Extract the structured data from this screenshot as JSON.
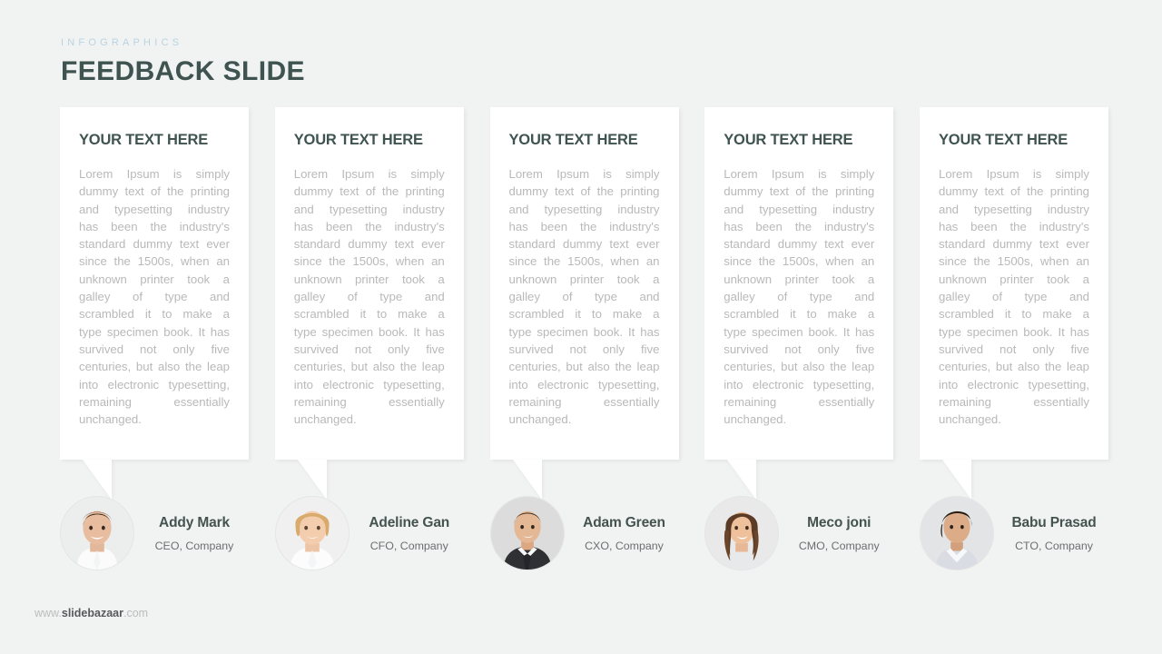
{
  "header": {
    "eyebrow": "INFOGRAPHICS",
    "title": "FEEDBACK SLIDE"
  },
  "colors": {
    "background": "#f1f2f2",
    "card": "#ffffff",
    "heading": "#3f5450",
    "eyebrow": "#b8d4e2",
    "body_text": "#b9b9b9",
    "name": "#44534f",
    "role": "#6d6e71",
    "footer_brand": "#58595b"
  },
  "cards": [
    {
      "title": "YOUR TEXT HERE",
      "body": "Lorem Ipsum is simply dummy text of the printing and typesetting industry has been the industry's standard dummy text ever since the 1500s, when an unknown printer took a galley of type and scrambled it to make a type specimen book. It has survived not only five centuries, but also the leap into electronic typesetting, remaining essentially unchanged."
    },
    {
      "title": "YOUR TEXT HERE",
      "body": "Lorem Ipsum is simply dummy text of the printing and typesetting industry has been the industry's standard dummy text ever since the 1500s, when an unknown printer took a galley of type and scrambled it to make a type specimen book. It has survived not only five centuries, but also the leap into electronic typesetting, remaining essentially unchanged."
    },
    {
      "title": "YOUR TEXT HERE",
      "body": "Lorem Ipsum is simply dummy text of the printing and typesetting industry has been the industry's standard dummy text ever since the 1500s, when an unknown printer took a galley of type and scrambled it to make a type specimen book. It has survived not only five centuries, but also the leap into electronic typesetting, remaining essentially unchanged."
    },
    {
      "title": "YOUR TEXT HERE",
      "body": "Lorem Ipsum is simply dummy text of the printing and typesetting industry has been the industry's standard dummy text ever since the 1500s, when an unknown printer took a galley of type and scrambled it to make a type specimen book. It has survived not only five centuries, but also the leap into electronic typesetting, remaining essentially unchanged."
    },
    {
      "title": "YOUR TEXT HERE",
      "body": "Lorem Ipsum is simply dummy text of the printing and typesetting industry has been the industry's standard dummy text ever since the 1500s, when an unknown printer took a galley of type and scrambled it to make a type specimen book. It has survived not only five centuries, but also the leap into electronic typesetting, remaining essentially unchanged."
    }
  ],
  "people": [
    {
      "name": "Addy Mark",
      "role": "CEO, Company",
      "avatar": "photo-avatar-man-smiling"
    },
    {
      "name": "Adeline Gan",
      "role": "CFO, Company",
      "avatar": "photo-avatar-blonde-woman"
    },
    {
      "name": "Adam Green",
      "role": "CXO, Company",
      "avatar": "photo-avatar-man-suit-tie"
    },
    {
      "name": "Meco joni",
      "role": "CMO, Company",
      "avatar": "photo-avatar-brunette-woman"
    },
    {
      "name": "Babu Prasad",
      "role": "CTO, Company",
      "avatar": "photo-avatar-man-dark-hair"
    }
  ],
  "footer": {
    "prefix": "www.",
    "brand": "slidebazaar",
    "suffix": ".com"
  }
}
